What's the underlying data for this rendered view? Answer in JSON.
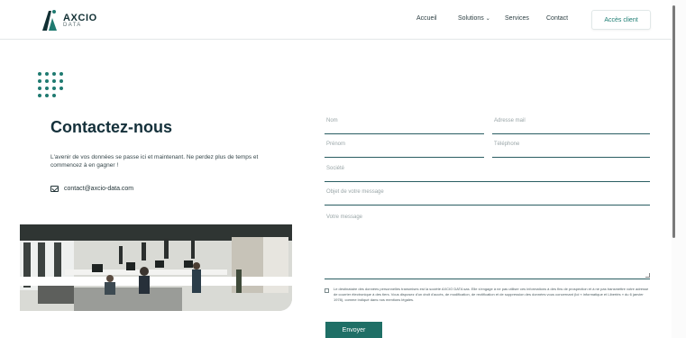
{
  "header": {
    "logo_text": "AXCIO",
    "logo_sub": "DATA",
    "nav": [
      "Accueil",
      "Solutions",
      "Services",
      "Contact"
    ],
    "client_button": "Accès client"
  },
  "content": {
    "title": "Contactez-nous",
    "lead": "L'avenir de vos données se passe ici et maintenant. Ne perdez plus de temps et commencez à en gagner !",
    "email": "contact@axcio-data.com"
  },
  "form": {
    "nom": "Nom",
    "email": "Adresse mail",
    "prenom": "Prénom",
    "telephone": "Téléphone",
    "societe": "Société",
    "objet": "Objet de votre message",
    "message": "Votre message",
    "consent": "Le destinataire des données personnelles transmises est la société AXCIO DATA sas. Elle s'engage à ne pas utiliser ces informations à des fins de prospection et à ne pas transmettre votre adresse de courrier électronique à des tiers. Vous disposez d'un droit d'accès, de modification, de rectification et de suppression des données vous concernant (loi « informatique et Libertés » du 6 janvier 1978), comme indiqué dans nos mentions légales.",
    "submit": "Envoyer"
  },
  "colors": {
    "brand": "#1f6f66",
    "title": "#14303a"
  }
}
